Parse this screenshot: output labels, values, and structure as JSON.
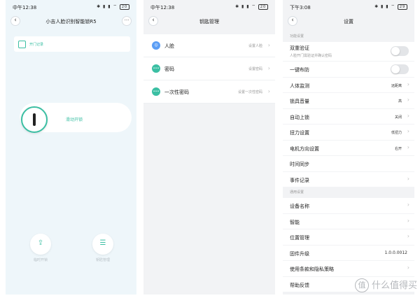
{
  "screen1": {
    "status": {
      "time": "中午12:38",
      "icons": "✱ ▮ ▮ ⌔",
      "battery": "20"
    },
    "title": "小吉人脸识别智能锁R5",
    "record_label": "开门记录",
    "swipe_label": "滑动开锁",
    "share_label": "临时开锁",
    "keys_label": "钥匙管理",
    "accent": "#3bbfa3"
  },
  "screen2": {
    "status": {
      "time": "中午12:38",
      "icons": "✱ ▮ ▮ ⌔",
      "battery": "20"
    },
    "title": "钥匙管理",
    "items": [
      {
        "label": "人脸",
        "value": "设置人脸",
        "icon": "face-icon",
        "icon_char": "☺",
        "color": "#5b9ef5"
      },
      {
        "label": "密码",
        "value": "设置密码",
        "icon": "password-icon",
        "icon_char": "•••",
        "color": "#3bbfa3"
      },
      {
        "label": "一次性密码",
        "value": "设置一次性密码",
        "icon": "otp-icon",
        "icon_char": "•••",
        "color": "#3bbfa3"
      }
    ]
  },
  "screen3": {
    "status": {
      "time": "下午3:08",
      "icons": "✱ ▮ ▮ ⌔",
      "battery": "29"
    },
    "title": "设置",
    "section1": "功能设置",
    "double_verify": {
      "label": "双重验证",
      "sub": "人脸开门需验证并确认密码"
    },
    "arm": {
      "label": "一键布防"
    },
    "rows_a": [
      {
        "label": "人体监测",
        "value": "远距离"
      },
      {
        "label": "锁具音量",
        "value": "高"
      },
      {
        "label": "自动上锁",
        "value": "关闭"
      },
      {
        "label": "扭力设置",
        "value": "低扭力"
      },
      {
        "label": "电机方向设置",
        "value": "右开"
      },
      {
        "label": "时间同步",
        "value": ""
      },
      {
        "label": "事件记录",
        "value": ""
      }
    ],
    "section2": "通用设置",
    "rows_b": [
      {
        "label": "设备名称",
        "value": ""
      },
      {
        "label": "智能",
        "value": ""
      },
      {
        "label": "位置管理",
        "value": ""
      }
    ],
    "firmware": {
      "label": "固件升级",
      "value": "1.0.0.0012"
    },
    "rows_c": [
      {
        "label": "使用条款和隐私策略",
        "value": ""
      },
      {
        "label": "帮助反馈",
        "value": ""
      }
    ]
  },
  "watermark": {
    "glyph": "值",
    "text": "什么值得买"
  }
}
